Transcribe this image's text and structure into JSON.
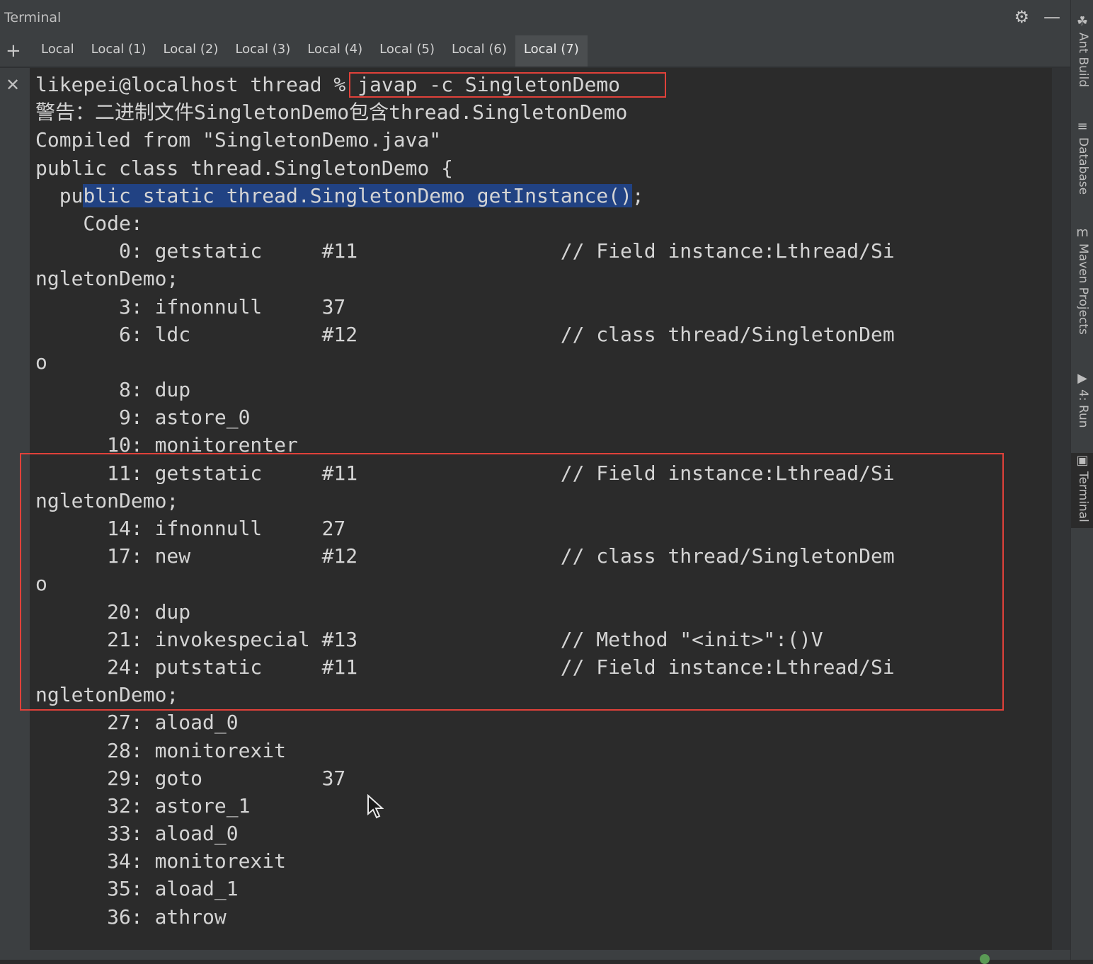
{
  "window": {
    "title": "Terminal"
  },
  "tabs": [
    {
      "label": "Local",
      "active": false
    },
    {
      "label": "Local (1)",
      "active": false
    },
    {
      "label": "Local (2)",
      "active": false
    },
    {
      "label": "Local (3)",
      "active": false
    },
    {
      "label": "Local (4)",
      "active": false
    },
    {
      "label": "Local (5)",
      "active": false
    },
    {
      "label": "Local (6)",
      "active": false
    },
    {
      "label": "Local (7)",
      "active": true
    }
  ],
  "side_tools": [
    "Ant Build",
    "Database",
    "Maven Projects",
    "4: Run",
    "Terminal"
  ],
  "icons": {
    "settings": "gear-icon",
    "minimize": "minimize-icon",
    "add": "plus-icon",
    "close": "close-icon"
  },
  "terminal": {
    "prompt": "likepei@localhost thread % ",
    "command": "javap -c SingletonDemo",
    "lines": [
      "警告：二进制文件SingletonDemo包含thread.SingletonDemo",
      "Compiled from \"SingletonDemo.java\"",
      "public class thread.SingletonDemo {",
      "",
      "    Code:",
      "       0: getstatic     #11                 // Field instance:Lthread/Si",
      "ngletonDemo;",
      "       3: ifnonnull     37",
      "       6: ldc           #12                 // class thread/SingletonDem",
      "o",
      "       8: dup",
      "       9: astore_0",
      "      10: monitorenter",
      "      11: getstatic     #11                 // Field instance:Lthread/Si",
      "ngletonDemo;",
      "      14: ifnonnull     27",
      "      17: new           #12                 // class thread/SingletonDem",
      "o",
      "      20: dup",
      "      21: invokespecial #13                 // Method \"<init>\":()V",
      "      24: putstatic     #11                 // Field instance:Lthread/Si",
      "ngletonDemo;",
      "      27: aload_0",
      "      28: monitorexit",
      "      29: goto          37",
      "      32: astore_1",
      "      33: aload_0",
      "      34: monitorexit",
      "      35: aload_1",
      "      36: athrow"
    ],
    "selected_line": {
      "before": "  pu",
      "selected": "blic static thread.SingletonDemo getInstance()",
      "after": ";"
    }
  },
  "colors": {
    "highlight_border": "#e0413a",
    "selection": "#214283",
    "text": "#d4d4d4",
    "background": "#2b2b2b"
  }
}
